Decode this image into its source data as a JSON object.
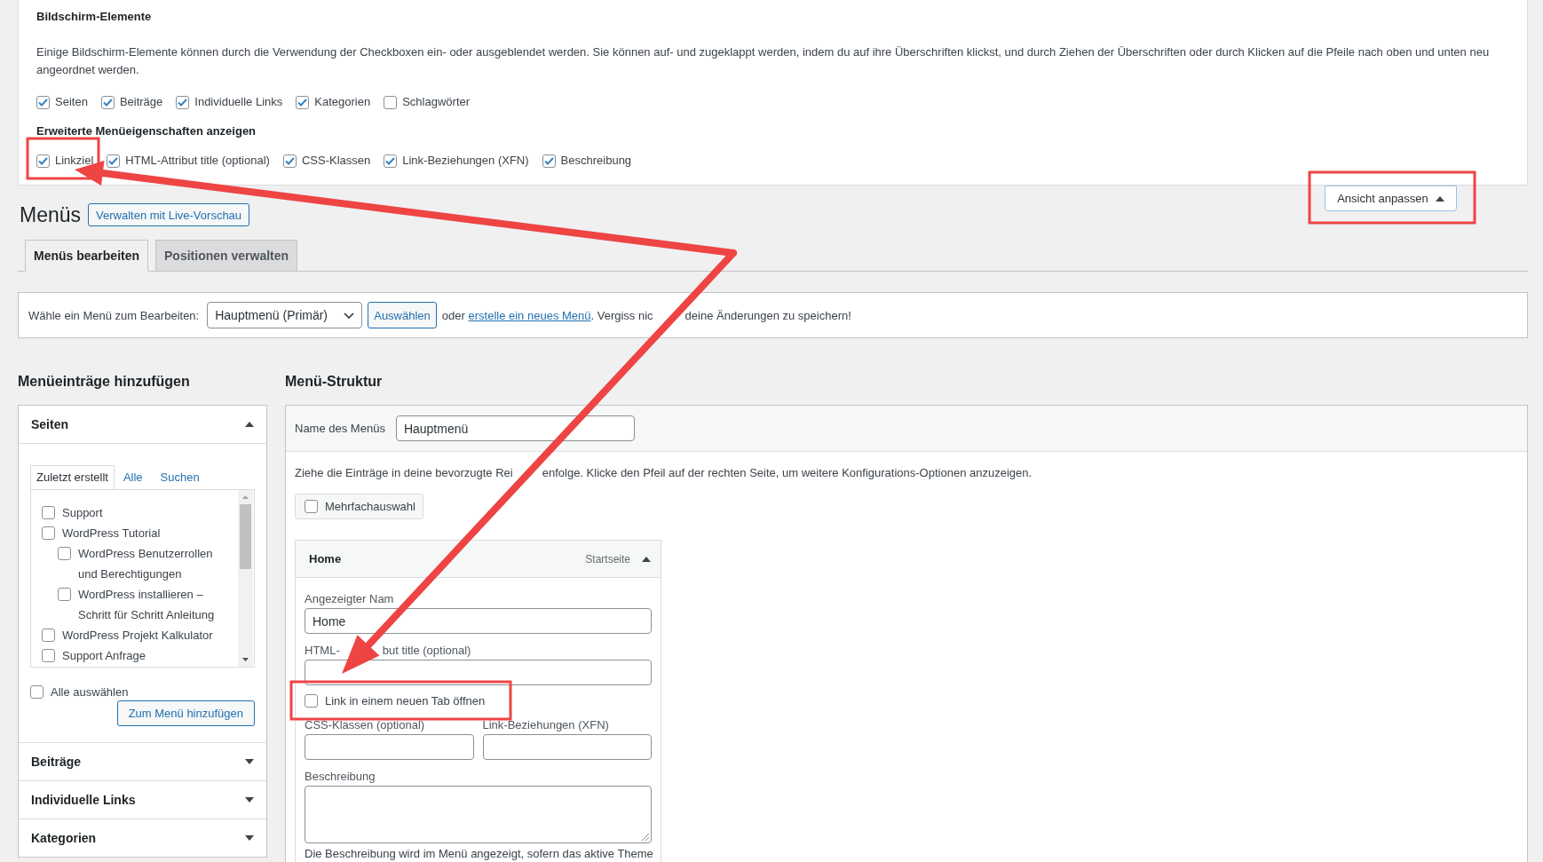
{
  "screen_options": {
    "title": "Bildschirm-Elemente",
    "description": "Einige Bildschirm-Elemente können durch die Verwendung der Checkboxen ein- oder ausgeblendet werden. Sie können auf- und zugeklappt werden, indem du auf ihre Überschriften klickst, und durch Ziehen der Überschriften oder durch Klicken auf die Pfeile nach oben und unten neu angeordnet werden.",
    "boxes": [
      {
        "label": "Seiten",
        "checked": true
      },
      {
        "label": "Beiträge",
        "checked": true
      },
      {
        "label": "Individuelle Links",
        "checked": true
      },
      {
        "label": "Kategorien",
        "checked": true
      },
      {
        "label": "Schlagwörter",
        "checked": false
      }
    ],
    "advanced_title": "Erweiterte Menüeigenschaften anzeigen",
    "advanced_boxes": [
      {
        "label": "Linkziel",
        "checked": true
      },
      {
        "label": "HTML-Attribut title (optional)",
        "checked": true
      },
      {
        "label": "CSS-Klassen",
        "checked": true
      },
      {
        "label": "Link-Beziehungen (XFN)",
        "checked": true
      },
      {
        "label": "Beschreibung",
        "checked": true
      }
    ]
  },
  "screen_options_toggle": {
    "label": "Ansicht anpassen",
    "expanded": true
  },
  "page": {
    "title": "Menüs",
    "action_button": "Verwalten mit Live-Vorschau"
  },
  "tabs": [
    {
      "label": "Menüs bearbeiten",
      "selected": true
    },
    {
      "label": "Positionen verwalten",
      "selected": false
    }
  ],
  "menu_select": {
    "label": "Wähle ein Menü zum Bearbeiten:",
    "value": "Hauptmenü (Primär)",
    "button": "Auswählen",
    "prefix": "oder",
    "link": "erstelle ein neues Menü",
    "suffix": [
      ". Vergiss nic",
      "deine Änderungen zu speichern!"
    ]
  },
  "add_items": {
    "title": "Menüeinträge hinzufügen",
    "sections": [
      {
        "title": "Seiten",
        "expanded": true,
        "tabs": [
          {
            "label": "Zuletzt erstellt",
            "selected": true
          },
          {
            "label": "Alle",
            "selected": false
          },
          {
            "label": "Suchen",
            "selected": false
          }
        ],
        "items": [
          {
            "label": "Support",
            "checked": false
          },
          {
            "label": "WordPress Tutorial",
            "checked": false,
            "children": [
              {
                "label": "WordPress Benutzerrollen und Berechtigungen",
                "checked": false
              },
              {
                "label": "WordPress installieren – Schritt für Schritt Anleitung",
                "checked": false
              }
            ]
          },
          {
            "label": "WordPress Projekt Kalkulator",
            "checked": false
          },
          {
            "label": "Support Anfrage",
            "checked": false
          }
        ],
        "select_all": {
          "label": "Alle auswählen",
          "checked": false
        },
        "button": "Zum Menü hinzufügen"
      },
      {
        "title": "Beiträge",
        "expanded": false
      },
      {
        "title": "Individuelle Links",
        "expanded": false
      },
      {
        "title": "Kategorien",
        "expanded": false
      }
    ]
  },
  "structure": {
    "title": "Menü-Struktur",
    "name_label": "Name des Menüs",
    "name_value": "Hauptmenü",
    "instructions": [
      "Ziehe die Einträge in deine bevorzugte Rei",
      "enfolge. Klicke den Pfeil auf der rechten Seite, um weitere Konfigurations-Optionen anzuzeigen."
    ],
    "bulk_select": {
      "label": "Mehrfachauswahl",
      "checked": false
    },
    "items": [
      {
        "title": "Home",
        "type": "Startseite",
        "expanded": true,
        "fields": [
          {
            "kind": "text",
            "label": "Angezeigter Nam",
            "value": "Home"
          },
          {
            "kind": "text",
            "label": [
              "HTML-",
              "but title (optional)"
            ]
          },
          {
            "kind": "checkbox",
            "label": "Link in einem neuen Tab öffnen",
            "checked": false
          },
          {
            "kind": "pair",
            "fields": [
              {
                "label": "CSS-Klassen (optional)"
              },
              {
                "label": "Link-Beziehungen (XFN)"
              }
            ]
          },
          {
            "kind": "textarea",
            "label": "Beschreibung",
            "note": "Die Beschreibung wird im Menü angezeigt, sofern das aktive Theme"
          }
        ]
      }
    ]
  }
}
